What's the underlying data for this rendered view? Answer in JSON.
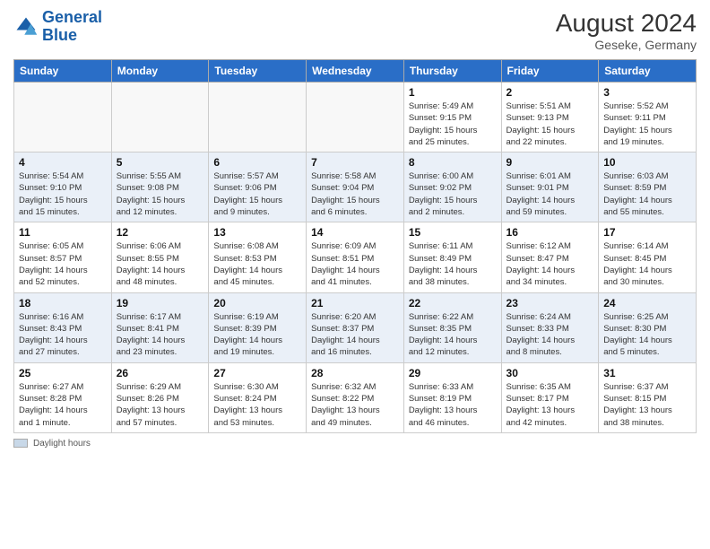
{
  "header": {
    "logo_line1": "General",
    "logo_line2": "Blue",
    "month_year": "August 2024",
    "location": "Geseke, Germany"
  },
  "days_of_week": [
    "Sunday",
    "Monday",
    "Tuesday",
    "Wednesday",
    "Thursday",
    "Friday",
    "Saturday"
  ],
  "weeks": [
    [
      {
        "day": "",
        "info": ""
      },
      {
        "day": "",
        "info": ""
      },
      {
        "day": "",
        "info": ""
      },
      {
        "day": "",
        "info": ""
      },
      {
        "day": "1",
        "info": "Sunrise: 5:49 AM\nSunset: 9:15 PM\nDaylight: 15 hours\nand 25 minutes."
      },
      {
        "day": "2",
        "info": "Sunrise: 5:51 AM\nSunset: 9:13 PM\nDaylight: 15 hours\nand 22 minutes."
      },
      {
        "day": "3",
        "info": "Sunrise: 5:52 AM\nSunset: 9:11 PM\nDaylight: 15 hours\nand 19 minutes."
      }
    ],
    [
      {
        "day": "4",
        "info": "Sunrise: 5:54 AM\nSunset: 9:10 PM\nDaylight: 15 hours\nand 15 minutes."
      },
      {
        "day": "5",
        "info": "Sunrise: 5:55 AM\nSunset: 9:08 PM\nDaylight: 15 hours\nand 12 minutes."
      },
      {
        "day": "6",
        "info": "Sunrise: 5:57 AM\nSunset: 9:06 PM\nDaylight: 15 hours\nand 9 minutes."
      },
      {
        "day": "7",
        "info": "Sunrise: 5:58 AM\nSunset: 9:04 PM\nDaylight: 15 hours\nand 6 minutes."
      },
      {
        "day": "8",
        "info": "Sunrise: 6:00 AM\nSunset: 9:02 PM\nDaylight: 15 hours\nand 2 minutes."
      },
      {
        "day": "9",
        "info": "Sunrise: 6:01 AM\nSunset: 9:01 PM\nDaylight: 14 hours\nand 59 minutes."
      },
      {
        "day": "10",
        "info": "Sunrise: 6:03 AM\nSunset: 8:59 PM\nDaylight: 14 hours\nand 55 minutes."
      }
    ],
    [
      {
        "day": "11",
        "info": "Sunrise: 6:05 AM\nSunset: 8:57 PM\nDaylight: 14 hours\nand 52 minutes."
      },
      {
        "day": "12",
        "info": "Sunrise: 6:06 AM\nSunset: 8:55 PM\nDaylight: 14 hours\nand 48 minutes."
      },
      {
        "day": "13",
        "info": "Sunrise: 6:08 AM\nSunset: 8:53 PM\nDaylight: 14 hours\nand 45 minutes."
      },
      {
        "day": "14",
        "info": "Sunrise: 6:09 AM\nSunset: 8:51 PM\nDaylight: 14 hours\nand 41 minutes."
      },
      {
        "day": "15",
        "info": "Sunrise: 6:11 AM\nSunset: 8:49 PM\nDaylight: 14 hours\nand 38 minutes."
      },
      {
        "day": "16",
        "info": "Sunrise: 6:12 AM\nSunset: 8:47 PM\nDaylight: 14 hours\nand 34 minutes."
      },
      {
        "day": "17",
        "info": "Sunrise: 6:14 AM\nSunset: 8:45 PM\nDaylight: 14 hours\nand 30 minutes."
      }
    ],
    [
      {
        "day": "18",
        "info": "Sunrise: 6:16 AM\nSunset: 8:43 PM\nDaylight: 14 hours\nand 27 minutes."
      },
      {
        "day": "19",
        "info": "Sunrise: 6:17 AM\nSunset: 8:41 PM\nDaylight: 14 hours\nand 23 minutes."
      },
      {
        "day": "20",
        "info": "Sunrise: 6:19 AM\nSunset: 8:39 PM\nDaylight: 14 hours\nand 19 minutes."
      },
      {
        "day": "21",
        "info": "Sunrise: 6:20 AM\nSunset: 8:37 PM\nDaylight: 14 hours\nand 16 minutes."
      },
      {
        "day": "22",
        "info": "Sunrise: 6:22 AM\nSunset: 8:35 PM\nDaylight: 14 hours\nand 12 minutes."
      },
      {
        "day": "23",
        "info": "Sunrise: 6:24 AM\nSunset: 8:33 PM\nDaylight: 14 hours\nand 8 minutes."
      },
      {
        "day": "24",
        "info": "Sunrise: 6:25 AM\nSunset: 8:30 PM\nDaylight: 14 hours\nand 5 minutes."
      }
    ],
    [
      {
        "day": "25",
        "info": "Sunrise: 6:27 AM\nSunset: 8:28 PM\nDaylight: 14 hours\nand 1 minute."
      },
      {
        "day": "26",
        "info": "Sunrise: 6:29 AM\nSunset: 8:26 PM\nDaylight: 13 hours\nand 57 minutes."
      },
      {
        "day": "27",
        "info": "Sunrise: 6:30 AM\nSunset: 8:24 PM\nDaylight: 13 hours\nand 53 minutes."
      },
      {
        "day": "28",
        "info": "Sunrise: 6:32 AM\nSunset: 8:22 PM\nDaylight: 13 hours\nand 49 minutes."
      },
      {
        "day": "29",
        "info": "Sunrise: 6:33 AM\nSunset: 8:19 PM\nDaylight: 13 hours\nand 46 minutes."
      },
      {
        "day": "30",
        "info": "Sunrise: 6:35 AM\nSunset: 8:17 PM\nDaylight: 13 hours\nand 42 minutes."
      },
      {
        "day": "31",
        "info": "Sunrise: 6:37 AM\nSunset: 8:15 PM\nDaylight: 13 hours\nand 38 minutes."
      }
    ]
  ],
  "legend": {
    "daylight_label": "Daylight hours"
  }
}
